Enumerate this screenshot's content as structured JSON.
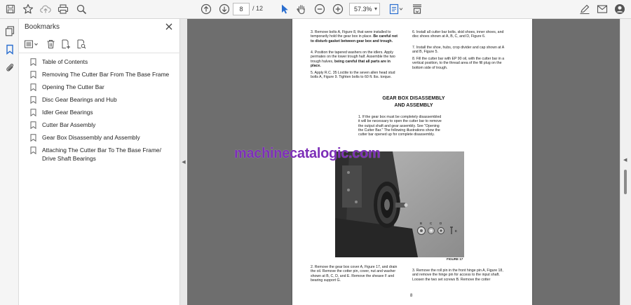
{
  "toolbar": {
    "page_current": "8",
    "page_total": "/ 12",
    "zoom": "57.3%"
  },
  "panel": {
    "title": "Bookmarks"
  },
  "bookmarks": [
    "Table of Contents",
    "Removing The Cutter Bar From The Base Frame",
    "Opening The Cutter Bar",
    "Disc Gear Bearings and Hub",
    "Idler Gear Bearings",
    "Cutter Bar Assembly",
    "Gear Box Disassembly and Assembly",
    "Attaching The Cutter Bar To The Base Frame/ Drive Shaft Bearings"
  ],
  "document": {
    "left_col_top": {
      "p3": "3. Remove bolts A, Figure 8, that were installed to temporarily hold the gear box in place.",
      "p3_bold": "Be careful not to disturb gasket between gear box and trough.",
      "p4": "4. Position the tapered washers on the idlers. Apply permatex on the lower trough half. Assemble the two trough halves,",
      "p4_bold": "being careful that all parts are in place.",
      "p5": "5. Apply R.C. 35 Loctite to the seven allen head stud bolts A, Figure 9. Tighten bolts to 60 ft. lbs. torque."
    },
    "right_col_top": {
      "p6": "6. Install all cutter bar bolts, skid shoes, inner shoes, and disc shoes shown at A, B, C, and D, Figure 6.",
      "p7": "7. Install the shoe, hubs, crop divider and cap shown at A and B, Figure 5.",
      "p8": "8. Fill the cutter bar with EP 90 oil, with the cutter bar in a vertical position, to the thread area of the fill plug on the bottom side of trough."
    },
    "section_heading_line1": "GEAR BOX DISASSEMBLY",
    "section_heading_line2": "AND ASSEMBLY",
    "intro": "1. If the gear box must be completely disassembled it will be necessary to open the cutter bar to remove the output shaft and gear assembly. See \"Opening the Cutter Bar.\" The following illustrations show the cutter bar opened up for complete disassembly.",
    "figure_caption": "FIGURE 17",
    "bottom_left": "2. Remove the gear box cover A, Figure 17, and drain the oil. Remove the cotter pin, cover, nut and washer shown at B, C, D, and E. Remove the sheave F and bearing support G.",
    "bottom_right": "3. Remove the roll pin in the front hinge pin A, Figure 18, and remove the hinge pin for access to the input shaft. Loosen the two set screws B. Remove the cotter",
    "page_number": "8",
    "photo_labels": [
      "B",
      "C",
      "D",
      "E"
    ],
    "watermark": "machinecatalogic.com"
  },
  "colors": {
    "watermark": "#7d2fb8",
    "accent_blue": "#2a6ecf",
    "viewer_bg": "#6e6e6e"
  }
}
